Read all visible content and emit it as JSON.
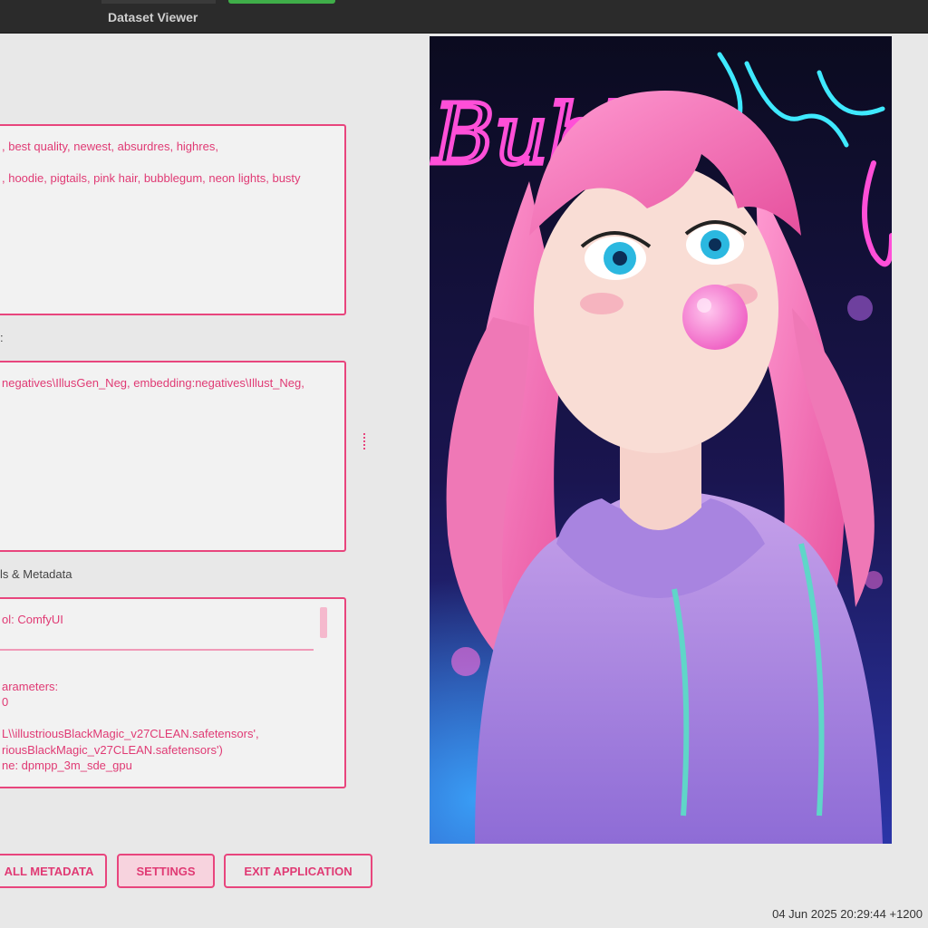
{
  "window": {
    "title": "Dataset Viewer"
  },
  "prompt_box": {
    "line1": ", best quality, newest, absurdres, highres,",
    "line2": ", hoodie, pigtails, pink hair, bubblegum, neon lights, busty"
  },
  "negative_label": ":",
  "negative_box": {
    "line1": "negatives\\IllusGen_Neg, embedding:negatives\\Illust_Neg,"
  },
  "details_label": "ls & Metadata",
  "details_box": {
    "line1": "ol: ComfyUI",
    "line2": "arameters:",
    "line3": "0",
    "line4": "L\\\\illustriousBlackMagic_v27CLEAN.safetensors',",
    "line5": "riousBlackMagic_v27CLEAN.safetensors')",
    "line6": "ne: dpmpp_3m_sde_gpu"
  },
  "buttons": {
    "all_metadata": "ALL METADATA",
    "settings": "SETTINGS",
    "exit": "EXIT APPLICATION"
  },
  "image": {
    "neon_text": "Bubbl"
  },
  "status": {
    "timestamp": "04 Jun 2025 20:29:44 +1200"
  },
  "colors": {
    "accent": "#e8457d",
    "accent_text": "#e03a74",
    "background": "#e8e8e8"
  }
}
